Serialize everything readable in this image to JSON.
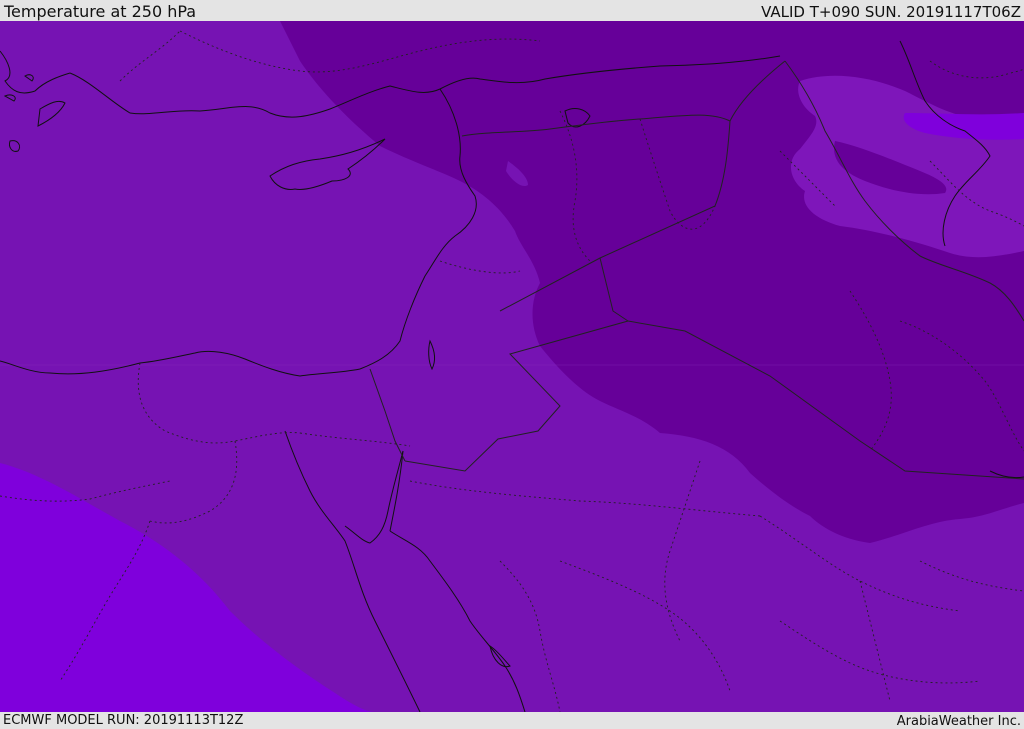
{
  "header": {
    "title": "Temperature at 250 hPa",
    "valid_time": "VALID T+090 SUN. 20191117T06Z"
  },
  "footer": {
    "model_run": "ECMWF MODEL RUN: 20191113T12Z",
    "credit": "ArabiaWeather Inc."
  },
  "map": {
    "colors": {
      "base_field": "#7613b3",
      "cold_core": "#660099",
      "warm_field": "#7f00dc",
      "iran_patch": "#7e16ba",
      "coastline": "#111111",
      "border": "#222222"
    }
  }
}
